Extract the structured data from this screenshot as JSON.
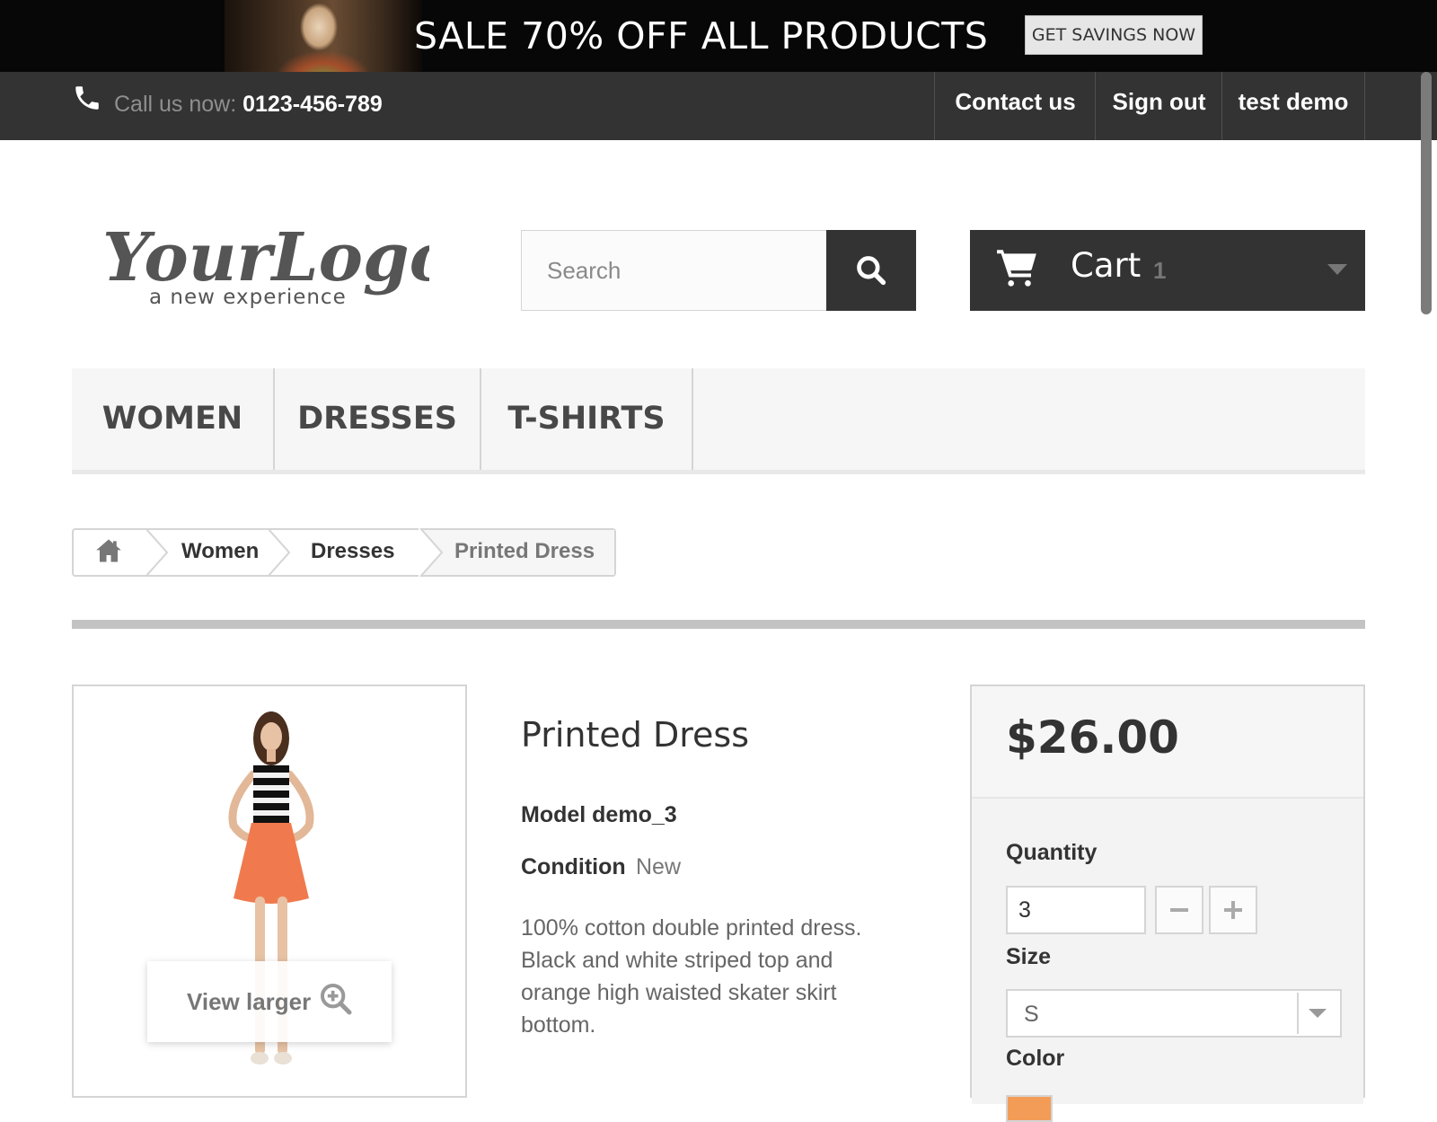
{
  "promo": {
    "title": "SALE 70% OFF ALL PRODUCTS",
    "button_label": "GET SAVINGS NOW"
  },
  "topnav": {
    "call_label": "Call us now:",
    "phone": "0123-456-789",
    "links": [
      "Contact us",
      "Sign out",
      "test demo"
    ]
  },
  "header": {
    "logo_text": "YourLogo",
    "logo_tagline": "a new experience",
    "search_placeholder": "Search",
    "cart_label": "Cart",
    "cart_count": "1"
  },
  "menu": {
    "items": [
      "WOMEN",
      "DRESSES",
      "T-SHIRTS"
    ]
  },
  "breadcrumb": {
    "items": [
      "Women",
      "Dresses",
      "Printed Dress"
    ]
  },
  "product": {
    "image_overlay": "View larger",
    "title": "Printed Dress",
    "model": "Model demo_3",
    "condition_label": "Condition",
    "condition_value": "New",
    "description": "100% cotton double printed dress. Black and white striped top and orange high waisted skater skirt bottom."
  },
  "buy": {
    "price": "$26.00",
    "quantity_label": "Quantity",
    "quantity_value": "3",
    "size_label": "Size",
    "size_value": "S",
    "color_label": "Color",
    "selected_color": "#f39c58"
  },
  "icons": [
    "phone-icon",
    "search-icon",
    "cart-icon",
    "chevron-down-icon",
    "home-icon",
    "zoom-in-icon",
    "minus-icon",
    "plus-icon"
  ],
  "colors": {
    "dark": "#333333",
    "promo_bg": "#070707",
    "menu_bg": "#f6f6f6",
    "border": "#d6d4d4"
  }
}
